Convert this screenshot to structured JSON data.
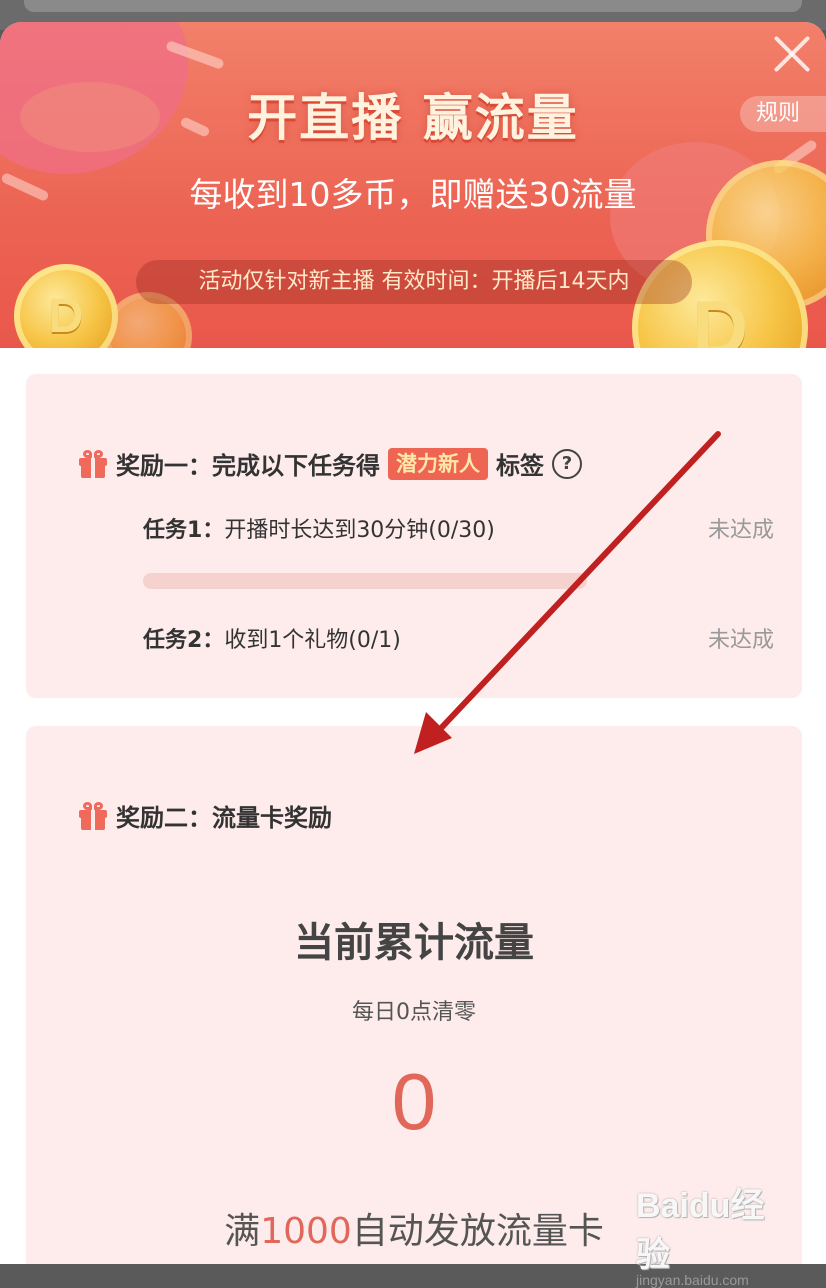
{
  "header": {
    "title": "开直播 赢流量",
    "subtitle": "每收到10多币，即赠送30流量",
    "notice": "活动仅针对新主播 有效时间：开播后14天内",
    "rules_label": "规则",
    "coin_glyph": "D"
  },
  "reward1": {
    "title_prefix": "奖励一：完成以下任务得",
    "tag": "潜力新人",
    "title_suffix": "标签",
    "help_glyph": "?",
    "tasks": [
      {
        "name": "任务1：",
        "desc": "开播时长达到30分钟(0/30)",
        "status": "未达成",
        "progress": 0
      },
      {
        "name": "任务2：",
        "desc": "收到1个礼物(0/1)",
        "status": "未达成"
      }
    ]
  },
  "reward2": {
    "title": "奖励二：流量卡奖励",
    "accum_title": "当前累计流量",
    "reset_note": "每日0点清零",
    "current_value": "0",
    "footer_prefix": "满",
    "footer_threshold": "1000",
    "footer_suffix": "自动发放流量卡"
  },
  "watermark": {
    "logo": "Baidu经验",
    "url": "jingyan.baidu.com"
  },
  "colors": {
    "accent": "#e9574b",
    "card_bg": "#fdeceb",
    "tag_bg": "#ef6553",
    "status_gray": "#999999",
    "annotation_arrow": "#c02020"
  }
}
